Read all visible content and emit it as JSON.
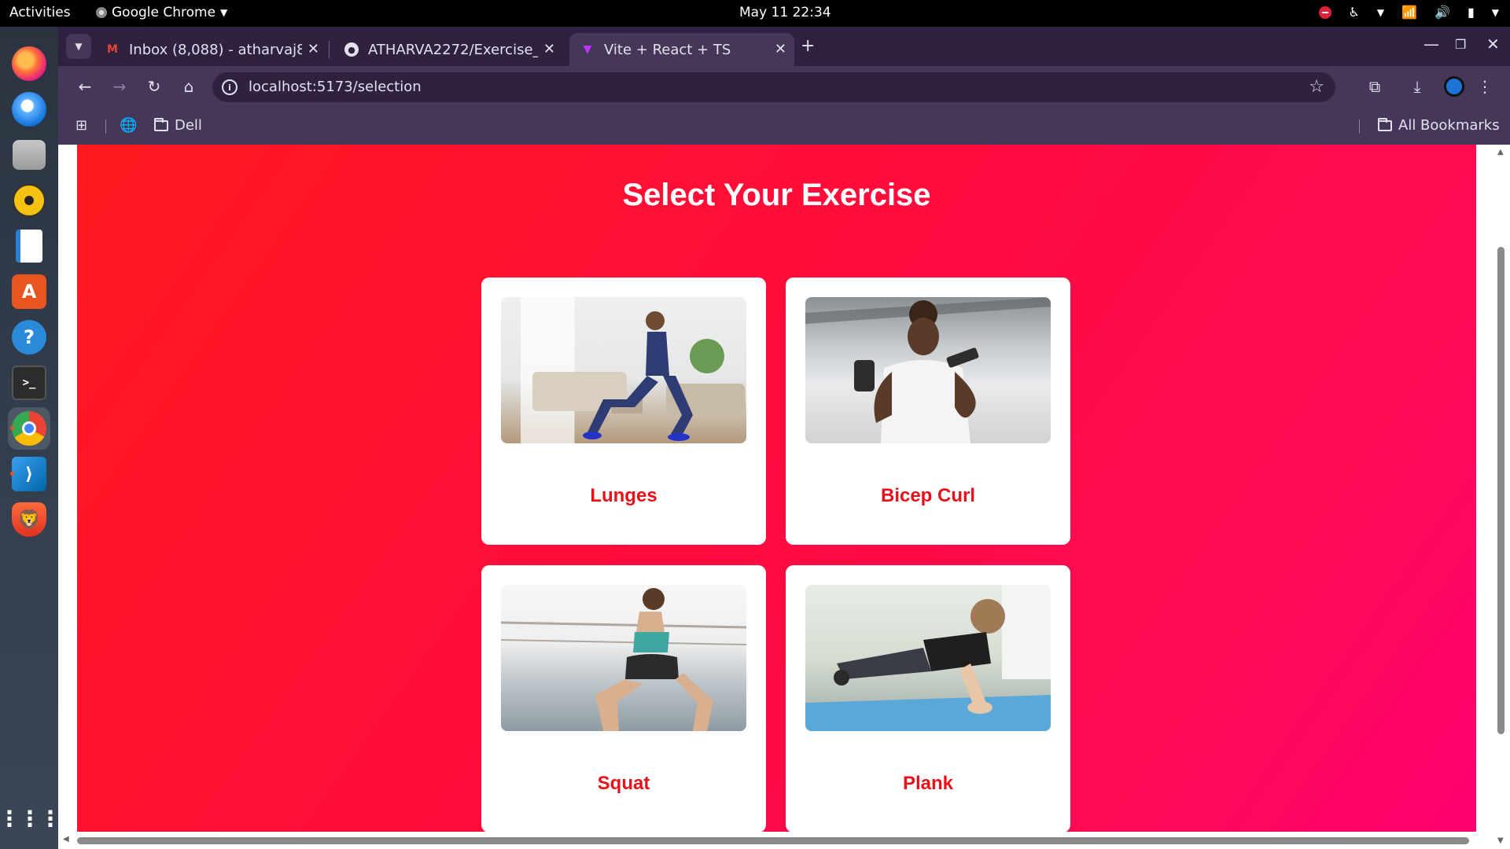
{
  "system": {
    "activities": "Activities",
    "app_name": "Google Chrome",
    "clock": "May 11  22:34"
  },
  "browser": {
    "tabs": [
      {
        "label": "Inbox (8,088) - atharvaj8",
        "icon": "gmail-icon"
      },
      {
        "label": "ATHARVA2272/Exercise_",
        "icon": "github-icon"
      },
      {
        "label": "Vite + React + TS",
        "icon": "vite-icon",
        "active": true
      }
    ],
    "url": "localhost:5173/selection",
    "bookmarks": {
      "folder": "Dell",
      "all": "All Bookmarks"
    }
  },
  "page": {
    "title": "Select Your Exercise",
    "exercises": [
      {
        "name": "Lunges"
      },
      {
        "name": "Bicep Curl"
      },
      {
        "name": "Squat"
      },
      {
        "name": "Plank"
      }
    ]
  },
  "colors": {
    "accent_red": "#e8101a",
    "gradient_start": "#ff1a1f",
    "gradient_end": "#ff0070",
    "chrome_frame": "#45375a"
  }
}
